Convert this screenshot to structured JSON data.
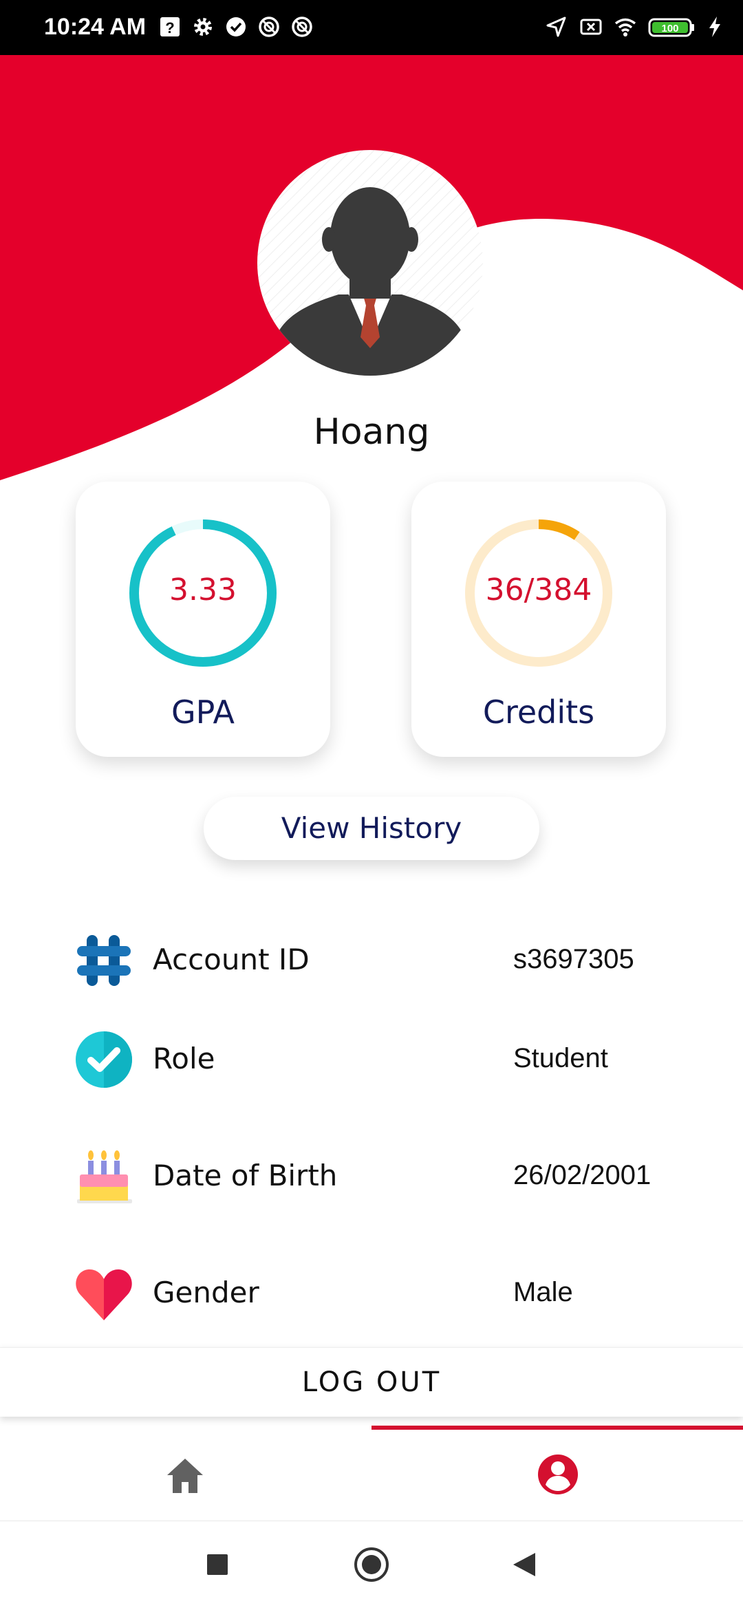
{
  "status_bar": {
    "time": "10:24 AM",
    "battery": "100"
  },
  "profile": {
    "name": "Hoang"
  },
  "stats": {
    "gpa": {
      "value": "3.33",
      "label": "GPA",
      "fraction": 0.93,
      "color": "#17c1c8",
      "track": "#e8fbfb"
    },
    "credits": {
      "value": "36/384",
      "label": "Credits",
      "fraction": 0.094,
      "color": "#f5a40a",
      "track": "#fdebcb"
    }
  },
  "actions": {
    "view_history": "View History",
    "log_out": "LOG OUT"
  },
  "info": {
    "account_id": {
      "label": "Account ID",
      "value": "s3697305",
      "icon": "hash-icon"
    },
    "role": {
      "label": "Role",
      "value": "Student",
      "icon": "check-badge-icon"
    },
    "dob": {
      "label": "Date of Birth",
      "value": "26/02/2001",
      "icon": "birthday-cake-icon"
    },
    "gender": {
      "label": "Gender",
      "value": "Male",
      "icon": "heart-icon"
    }
  },
  "colors": {
    "brand_red": "#e4002b",
    "navy": "#121b5a",
    "value_red": "#d4102f"
  },
  "nav": {
    "items": [
      "home-icon",
      "profile-icon"
    ],
    "active": "profile"
  }
}
